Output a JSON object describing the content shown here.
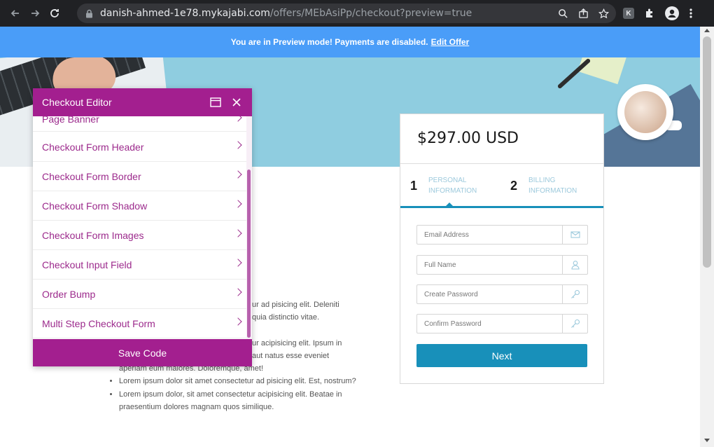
{
  "browser": {
    "url_host": "danish-ahmed-1e78.mykajabi.com",
    "url_path": "/offers/MEbAsiPp/checkout?preview=true",
    "extension_k": "K"
  },
  "preview_banner": {
    "message": "You are in Preview mode! Payments are disabled.",
    "link": "Edit Offer"
  },
  "body_text": {
    "p1_line1": "ur ad pisicing elit. Deleniti",
    "p1_line2": "quia distinctio vitae.",
    "p2_line1": "ur acipisicing elit. Ipsum in",
    "p2_line2": "aut natus esse eveniet",
    "p2_line3": "aperiam eum maiores. Doloremque, amet!",
    "bullets": [
      "Lorem ipsum dolor sit amet consectetur ad pisicing elit. Est, nostrum?",
      "Lorem ipsum dolor, sit amet consectetur acipisicing elit. Beatae in praesentium dolores magnam quos similique."
    ]
  },
  "checkout": {
    "price": "$297.00 USD",
    "steps": [
      {
        "num": "1",
        "label_1": "PERSONAL",
        "label_2": "INFORMATION"
      },
      {
        "num": "2",
        "label_1": "BILLING",
        "label_2": "INFORMATION"
      }
    ],
    "fields": {
      "email": "Email Address",
      "full_name": "Full Name",
      "password": "Create Password",
      "confirm_password": "Confirm Password"
    },
    "next_label": "Next",
    "accent_color": "#1890ba"
  },
  "editor": {
    "title": "Checkout Editor",
    "items": [
      "Page Banner",
      "Checkout Form Header",
      "Checkout Form Border",
      "Checkout Form Shadow",
      "Checkout Form Images",
      "Checkout Input Field",
      "Order Bump",
      "Multi Step Checkout Form"
    ],
    "save_label": "Save Code",
    "accent_color": "#a31f8f"
  }
}
